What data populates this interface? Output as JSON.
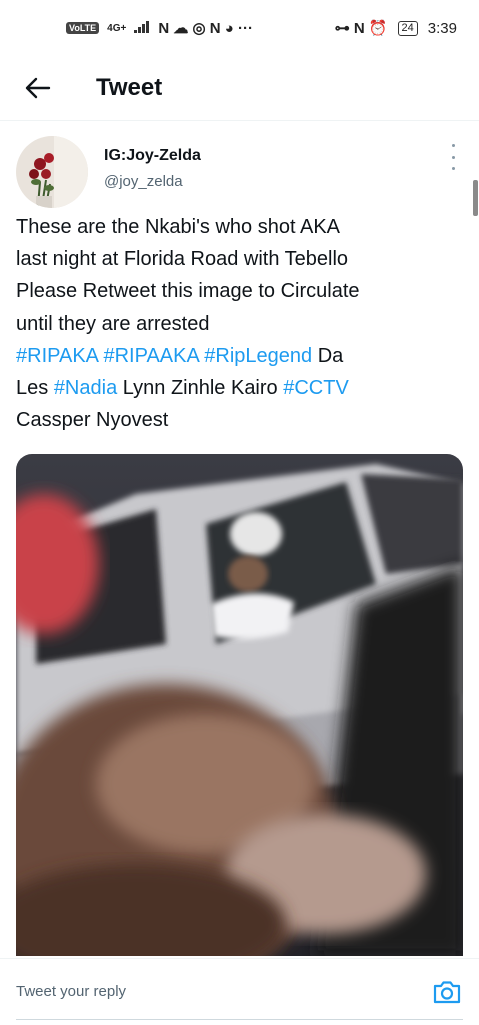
{
  "status_bar": {
    "volte": "VoLTE",
    "network": "4G+",
    "left_glyphs": "N ☁ ◎ N ◕ ···",
    "right_glyphs": "⊶ N ⏰",
    "battery": "24",
    "time": "3:39"
  },
  "header": {
    "title": "Tweet",
    "back_icon": "arrow-left-icon"
  },
  "tweet": {
    "author_name": "IG:Joy-Zelda",
    "author_handle": "@joy_zelda",
    "text_lines": [
      {
        "parts": [
          {
            "t": "These are the Nkabi's who shot AKA",
            "h": false
          }
        ]
      },
      {
        "parts": [
          {
            "t": "last night at Florida Road with Tebello",
            "h": false
          }
        ]
      },
      {
        "parts": [
          {
            "t": "Please Retweet this image to Circulate",
            "h": false
          }
        ]
      },
      {
        "parts": [
          {
            "t": "until they are arrested",
            "h": false
          }
        ]
      },
      {
        "parts": [
          {
            "t": "#RIPAKA",
            "h": true
          },
          {
            "t": " ",
            "h": false
          },
          {
            "t": "#RIPAAKA",
            "h": true
          },
          {
            "t": " ",
            "h": false
          },
          {
            "t": "#RipLegend",
            "h": true
          },
          {
            "t": " Da",
            "h": false
          }
        ]
      },
      {
        "parts": [
          {
            "t": "Les ",
            "h": false
          },
          {
            "t": "#Nadia",
            "h": true
          },
          {
            "t": " Lynn Zinhle Kairo ",
            "h": false
          },
          {
            "t": "#CCTV",
            "h": true
          }
        ]
      },
      {
        "parts": [
          {
            "t": "Cassper Nyovest",
            "h": false
          }
        ]
      }
    ],
    "hashtag_color": "#1d9bf0",
    "more_icon": "more-vertical-icon",
    "media_description": "CCTV-style photo of a white car"
  },
  "reply": {
    "placeholder": "Tweet your reply",
    "camera_icon": "camera-icon",
    "accent": "#1d9bf0"
  }
}
